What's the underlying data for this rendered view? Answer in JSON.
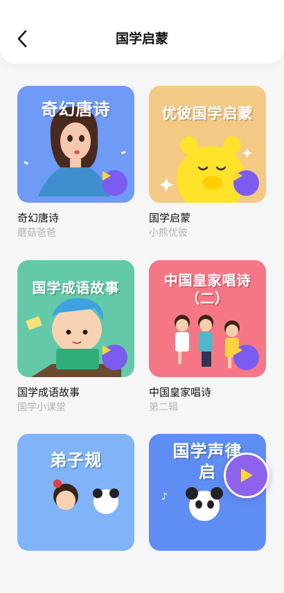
{
  "header": {
    "title": "国学启蒙",
    "back_icon": "chevron-left-icon"
  },
  "albums": [
    {
      "cover_title": "奇幻唐诗",
      "name": "奇幻唐诗",
      "subtitle": "蘑菇爸爸",
      "cover_color": "#6f9af6"
    },
    {
      "cover_title": "优彼国学启蒙",
      "name": "国学启蒙",
      "subtitle": "小熊优彼",
      "cover_color": "#f3c985"
    },
    {
      "cover_title": "国学成语故事",
      "name": "国学成语故事",
      "subtitle": "国学小课堂",
      "cover_color": "#64c9a8"
    },
    {
      "cover_title": "中国皇家唱诗（二）",
      "name": "中国皇家唱诗",
      "subtitle": "第二辑",
      "cover_color": "#f57785"
    },
    {
      "cover_title": "弟子规",
      "name": "",
      "subtitle": "",
      "cover_color": "#80b3f8"
    },
    {
      "cover_title": "国学声律启",
      "name": "",
      "subtitle": "",
      "cover_color": "#5e8ef3"
    }
  ],
  "colors": {
    "accent": "#7c5cf0",
    "background": "#f6f6f7"
  },
  "floating_player": {
    "icon": "play-icon"
  }
}
